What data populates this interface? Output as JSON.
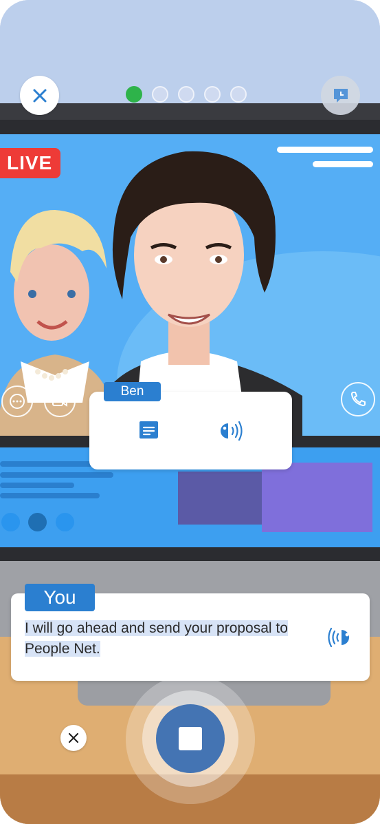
{
  "header": {
    "close_icon": "close-icon",
    "progress_steps": 5,
    "progress_current": 1,
    "hint_icon": "chat-clock-icon"
  },
  "video": {
    "live_label": "LIVE",
    "live_color": "#ee3b37"
  },
  "speaker_card": {
    "name": "Ben",
    "icons": [
      "transcript-icon",
      "play-audio-icon"
    ]
  },
  "user_card": {
    "label": "You",
    "text": "I will go ahead and send your proposal to People Net.",
    "icon": "listen-audio-icon"
  },
  "controls": {
    "cancel_icon": "close-icon",
    "stop_icon": "stop-icon",
    "stop_color": "#4474b3"
  },
  "colors": {
    "accent": "#2b7fd0",
    "progress_active": "#2eb34a"
  }
}
